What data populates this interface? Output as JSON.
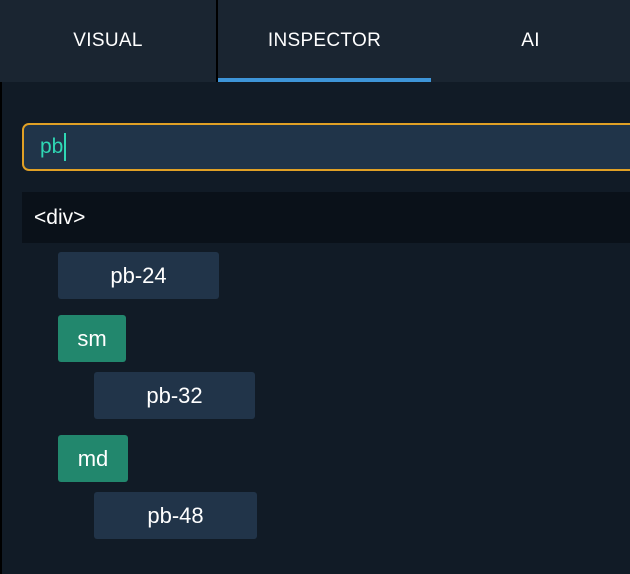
{
  "tabs": [
    {
      "label": "VISUAL",
      "active": false
    },
    {
      "label": "INSPECTOR",
      "active": true
    },
    {
      "label": "AI",
      "active": false
    }
  ],
  "search": {
    "value": "pb",
    "focused": true
  },
  "element": {
    "tag": "<div>"
  },
  "class_groups": [
    {
      "breakpoint": null,
      "classes": [
        "pb-24"
      ]
    },
    {
      "breakpoint": "sm",
      "classes": [
        "pb-32"
      ]
    },
    {
      "breakpoint": "md",
      "classes": [
        "pb-48"
      ]
    }
  ],
  "colors": {
    "accent_active_tab": "#3e95d8",
    "search_border": "#e0a025",
    "search_text": "#2fd7b4",
    "breakpoint_chip": "#22876d",
    "class_chip": "#213449"
  }
}
